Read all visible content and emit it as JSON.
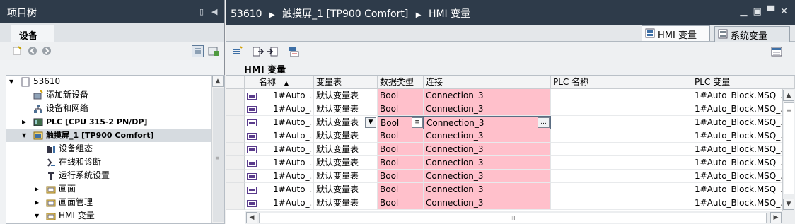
{
  "left_panel": {
    "title": "项目树",
    "pin_glyph": "▯",
    "collapse_glyph": "◀",
    "tab_label": "设备",
    "tree": [
      {
        "label": "53610",
        "icon": "project-icon",
        "expand": "▼",
        "indent": 0
      },
      {
        "label": "添加新设备",
        "icon": "add-device-icon",
        "expand": "",
        "indent": 1
      },
      {
        "label": "设备和网络",
        "icon": "network-icon",
        "expand": "",
        "indent": 1
      },
      {
        "label": "PLC [CPU 315-2 PN/DP]",
        "icon": "plc-icon",
        "expand": "▶",
        "indent": 1
      },
      {
        "label": "触摸屏_1 [TP900 Comfort]",
        "icon": "hmi-device-icon",
        "expand": "▼",
        "indent": 1,
        "selected": true
      },
      {
        "label": "设备组态",
        "icon": "device-config-icon",
        "expand": "",
        "indent": 2
      },
      {
        "label": "在线和诊断",
        "icon": "diagnostics-icon",
        "expand": "",
        "indent": 2
      },
      {
        "label": "运行系统设置",
        "icon": "runtime-settings-icon",
        "expand": "",
        "indent": 2
      },
      {
        "label": "画面",
        "icon": "folder-icon",
        "expand": "▶",
        "indent": 2
      },
      {
        "label": "画面管理",
        "icon": "folder-icon",
        "expand": "▶",
        "indent": 2
      },
      {
        "label": "HMI 变量",
        "icon": "folder-icon",
        "expand": "▼",
        "indent": 2
      }
    ]
  },
  "right_panel": {
    "breadcrumb": [
      "53610",
      "触摸屏_1 [TP900 Comfort]",
      "HMI 变量"
    ],
    "breadcrumb_sep": "▶",
    "window_controls": "▁ ▣ ▀ ✕",
    "tabs": [
      {
        "label": "HMI 变量",
        "active": true
      },
      {
        "label": "系统变量",
        "active": false
      }
    ],
    "section_title": "HMI 变量",
    "table": {
      "columns": [
        "名称",
        "变量表",
        "数据类型",
        "连接",
        "PLC 名称",
        "PLC 变量"
      ],
      "sort_glyph": "▲",
      "rows": [
        {
          "name": "1#Auto_...",
          "table": "默认变量表",
          "type": "Bool",
          "conn": "Connection_3",
          "plc_name": "",
          "plc_tag": "1#Auto_Block.MSQ_..."
        },
        {
          "name": "1#Auto_...",
          "table": "默认变量表",
          "type": "Bool",
          "conn": "Connection_3",
          "plc_name": "",
          "plc_tag": "1#Auto_Block.MSQ_..."
        },
        {
          "name": "1#Auto_...",
          "table": "默认变量表",
          "type": "Bool",
          "conn": "Connection_3",
          "plc_name": "",
          "plc_tag": "1#Auto_Block.MSQ_...",
          "editing": true
        },
        {
          "name": "1#Auto_...",
          "table": "默认变量表",
          "type": "Bool",
          "conn": "Connection_3",
          "plc_name": "",
          "plc_tag": "1#Auto_Block.MSQ_..."
        },
        {
          "name": "1#Auto_...",
          "table": "默认变量表",
          "type": "Bool",
          "conn": "Connection_3",
          "plc_name": "",
          "plc_tag": "1#Auto_Block.MSQ_..."
        },
        {
          "name": "1#Auto_...",
          "table": "默认变量表",
          "type": "Bool",
          "conn": "Connection_3",
          "plc_name": "",
          "plc_tag": "1#Auto_Block.MSQ_..."
        },
        {
          "name": "1#Auto_...",
          "table": "默认变量表",
          "type": "Bool",
          "conn": "Connection_3",
          "plc_name": "",
          "plc_tag": "1#Auto_Block.MSQ_..."
        },
        {
          "name": "1#Auto_...",
          "table": "默认变量表",
          "type": "Bool",
          "conn": "Connection_3",
          "plc_name": "",
          "plc_tag": "1#Auto_Block.MSQ_..."
        },
        {
          "name": "1#Auto_...",
          "table": "默认变量表",
          "type": "Bool",
          "conn": "Connection_3",
          "plc_name": "",
          "plc_tag": "1#Auto_Block.MSQ_..."
        }
      ]
    },
    "dropdown_glyph": "▼",
    "ellipsis_button": "...",
    "scroll_glyph_h": "III"
  },
  "colors": {
    "title_bar": "#2e3b4a",
    "pink_cell": "#ffc0cb",
    "selection": "#d6dbe0"
  }
}
